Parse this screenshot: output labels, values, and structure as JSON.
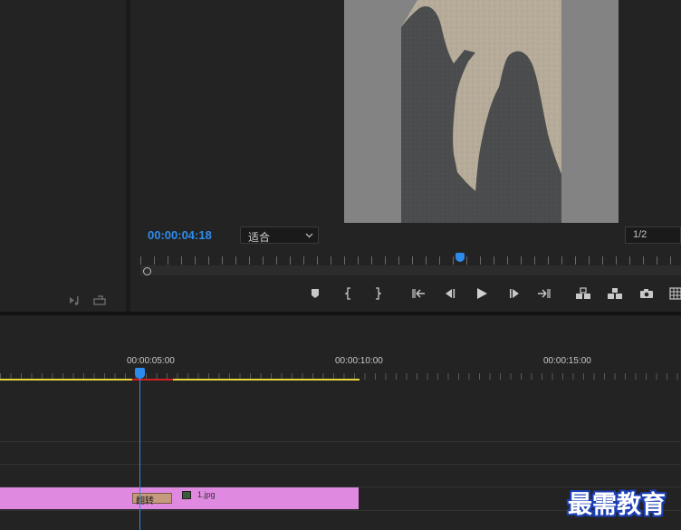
{
  "program_monitor": {
    "timecode": "00:00:04:18",
    "fit_select": {
      "value": "适合"
    },
    "resolution_select": {
      "value": "1/2"
    },
    "controls": [
      {
        "name": "add-marker-button",
        "icon": "marker-icon"
      },
      {
        "name": "mark-in-button",
        "icon": "mark-in-icon"
      },
      {
        "name": "mark-out-button",
        "icon": "mark-out-icon"
      },
      {
        "name": "go-to-in-button",
        "icon": "go-to-in-icon"
      },
      {
        "name": "step-back-button",
        "icon": "step-back-icon"
      },
      {
        "name": "play-button",
        "icon": "play-icon"
      },
      {
        "name": "step-forward-button",
        "icon": "step-forward-icon"
      },
      {
        "name": "go-to-out-button",
        "icon": "go-to-out-icon"
      },
      {
        "name": "lift-button",
        "icon": "lift-icon"
      },
      {
        "name": "extract-button",
        "icon": "extract-icon"
      },
      {
        "name": "export-frame-button",
        "icon": "camera-icon"
      },
      {
        "name": "comparison-view-button",
        "icon": "comparison-view-icon"
      }
    ]
  },
  "source_panel": {
    "icons": [
      "insert-audio-icon",
      "overwrite-icon"
    ]
  },
  "timeline": {
    "ruler_labels": [
      "00:00:05:00",
      "00:00:10:00",
      "00:00:15:00"
    ],
    "clip": {
      "name": "1.jpg",
      "effect_badge": "翻转",
      "color": "#e089e0"
    }
  },
  "colors": {
    "accent": "#2d8ceb",
    "work_area": "#e8d43c",
    "render_bar": "#d02020",
    "effect_badge": "#c69b7d"
  },
  "watermark": {
    "text": "最需教育"
  }
}
